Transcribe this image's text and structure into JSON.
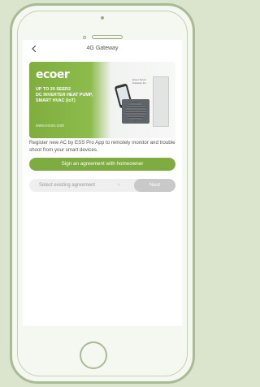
{
  "header": {
    "title": "4G Gateway"
  },
  "banner": {
    "brand": "ecoer",
    "headline_lines": [
      "UP TO 20 SEER2",
      "DC INVERTER HEAT PUMP,",
      "SMART HVAC (IoT)"
    ],
    "url": "www.ecoer.com",
    "device_caption": "Ecoer Smart Gateway 4G"
  },
  "description": "Register new AC by ESS Pro App to remotely monitor and trouble shoot from your smart devices.",
  "actions": {
    "sign_label": "Sign an agreement with homeowner",
    "select_label": "Select existing agreement",
    "next_label": "Next"
  },
  "colors": {
    "accent": "#7fac41",
    "disabled": "#c9c9c9",
    "frame": "#a8bb92"
  }
}
